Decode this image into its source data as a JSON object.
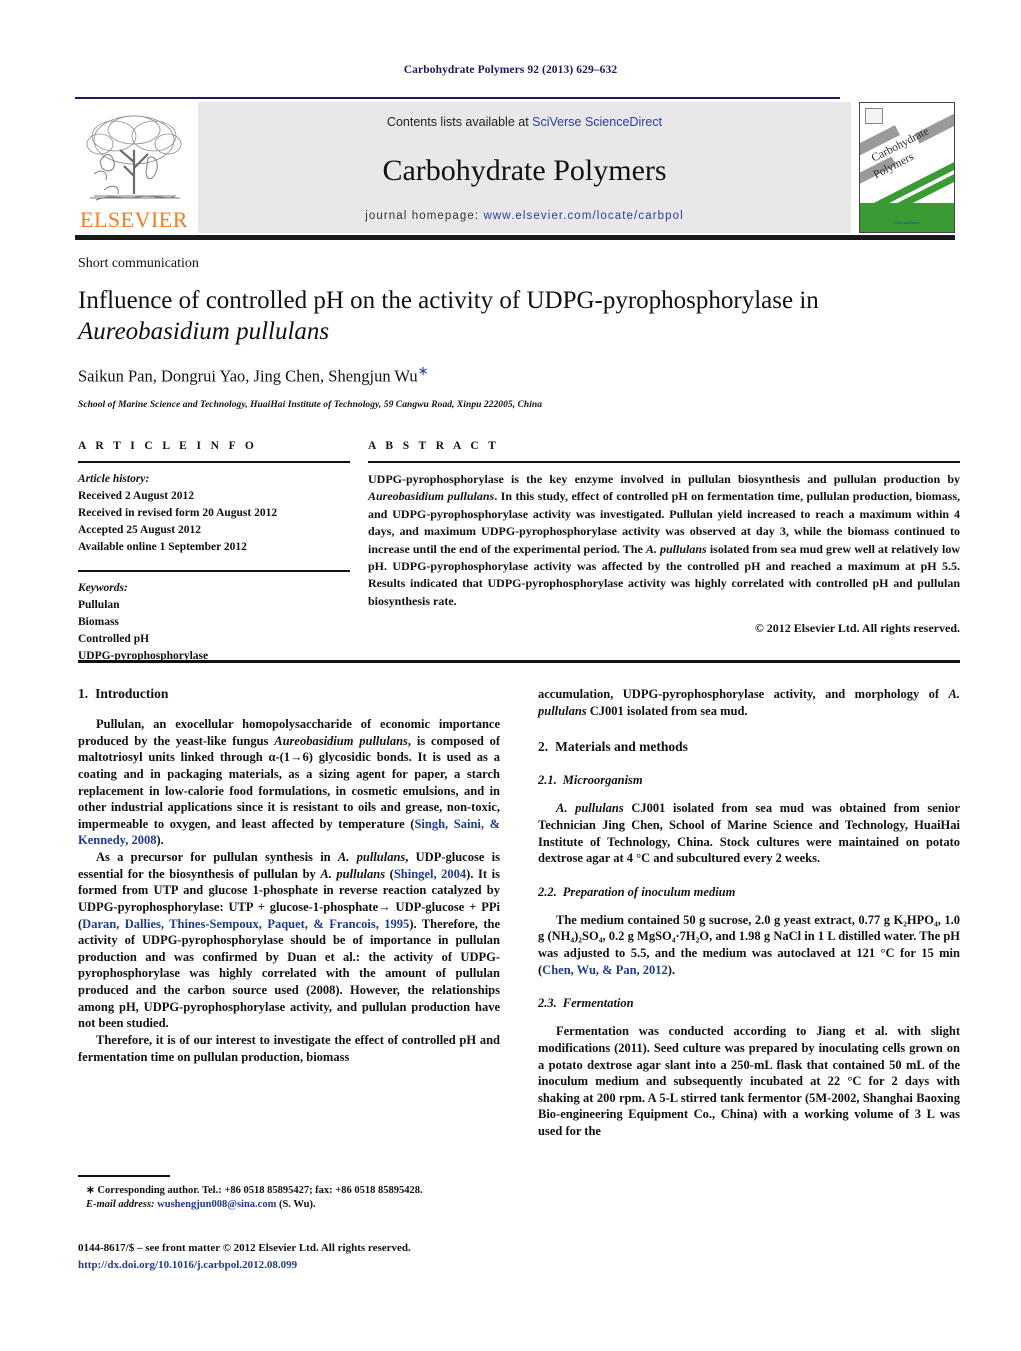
{
  "header": {
    "citation": "Carbohydrate Polymers 92 (2013) 629–632",
    "contents_prefix": "Contents lists available at ",
    "contents_link": "SciVerse ScienceDirect",
    "journal_title": "Carbohydrate Polymers",
    "homepage_prefix": "journal homepage: ",
    "homepage_url": "www.elsevier.com/locate/carbpol",
    "publisher_logo_text": "ELSEVIER",
    "cover": {
      "line1": "Carbohydrate",
      "line2": "Polymers",
      "sciencedirect": "ScienceDirect"
    },
    "colors": {
      "link_blue": "#2b3fa0",
      "elsevier_orange": "#F47B20",
      "band_gray": "#e8e8ea",
      "navy": "#1a1a5e",
      "cover_green": "#3a9b35"
    }
  },
  "title_block": {
    "doctype": "Short communication",
    "title_part1": "Influence of controlled pH on the activity of UDPG-pyrophosphorylase in ",
    "title_italic": "Aureobasidium pullulans",
    "authors": "Saikun Pan, Dongrui Yao, Jing Chen, Shengjun Wu",
    "corresponding_marker": "∗",
    "affiliation": "School of Marine Science and Technology, HuaiHai Institute of Technology, 59 Cangwu Road, Xinpu 222005, China"
  },
  "article_info": {
    "heading": "A R T I C L E    I N F O",
    "history_label": "Article history:",
    "history": [
      "Received 2 August 2012",
      "Received in revised form 20 August 2012",
      "Accepted 25 August 2012",
      "Available online 1 September 2012"
    ],
    "keywords_label": "Keywords:",
    "keywords": [
      "Pullulan",
      "Biomass",
      "Controlled pH",
      "UDPG-pyrophosphorylase"
    ]
  },
  "abstract": {
    "heading": "A B S T R A C T",
    "s1": "UDPG-pyrophosphorylase is the key enzyme involved in pullulan biosynthesis and pullulan production by ",
    "s2_italic": "Aureobasidium pullulans",
    "s3": ". In this study, effect of controlled pH on fermentation time, pullulan production, biomass, and UDPG-pyrophosphorylase activity was investigated. Pullulan yield increased to reach a maximum within 4 days, and maximum UDPG-pyrophosphorylase activity was observed at day 3, while the biomass continued to increase until the end of the experimental period. The ",
    "s4_italic": "A. pullulans",
    "s5": " isolated from sea mud grew well at relatively low pH. UDPG-pyrophosphorylase activity was affected by the controlled pH and reached a maximum at pH 5.5. Results indicated that UDPG-pyrophosphorylase activity was highly correlated with controlled pH and pullulan biosynthesis rate.",
    "copyright": "© 2012 Elsevier Ltd. All rights reserved."
  },
  "body": {
    "left": {
      "intro_num": "1.",
      "intro_title": "Introduction",
      "p1_a": "Pullulan, an exocellular homopolysaccharide of economic importance produced by the yeast-like fungus ",
      "p1_ital": "Aureobasidium pullulans",
      "p1_b": ", is composed of maltotriosyl units linked through α-(1→6) glycosidic bonds. It is used as a coating and in packaging materials, as a sizing agent for paper, a starch replacement in low-calorie food formulations, in cosmetic emulsions, and in other industrial applications since it is resistant to oils and grease, non-toxic, impermeable to oxygen, and least affected by temperature (",
      "p1_ref": "Singh, Saini, & Kennedy, 2008",
      "p1_c": ").",
      "p2_a": "As a precursor for pullulan synthesis in ",
      "p2_ital1": "A. pullulans",
      "p2_b": ", UDP-glucose is essential for the biosynthesis of pullulan by ",
      "p2_ital2": "A. pullulans",
      "p2_c": " (",
      "p2_ref1": "Shingel, 2004",
      "p2_d": "). It is formed from UTP and glucose 1-phosphate in reverse reaction catalyzed by UDPG-pyrophosphorylase: UTP + glucose-1-phosphate→ UDP-glucose + PPi (",
      "p2_ref2": "Daran, Dallies, Thines-Sempoux, Paquet, & Francois, 1995",
      "p2_e": "). Therefore, the activity of UDPG-pyrophosphorylase should be of importance in pullulan production and was confirmed by Duan et al.: the activity of UDPG-pyrophosphorylase was highly correlated with the amount of pullulan produced and the carbon source used (2008). However, the relationships among pH, UDPG-pyrophosphorylase activity, and pullulan production have not been studied.",
      "p3": "Therefore, it is of our interest to investigate the effect of controlled pH and fermentation time on pullulan production, biomass"
    },
    "right": {
      "p_cont_a": "accumulation, UDPG-pyrophosphorylase activity, and morphology of ",
      "p_cont_ital": "A. pullulans",
      "p_cont_b": " CJ001 isolated from sea mud.",
      "mm_num": "2.",
      "mm_title": "Materials and methods",
      "s21_num": "2.1.",
      "s21_title": "Microorganism",
      "s21_a_ital": "A. pullulans",
      "s21_a": " CJ001 isolated from sea mud was obtained from senior Technician Jing Chen, School of Marine Science and Technology, HuaiHai Institute of Technology, China. Stock cultures were maintained on potato dextrose agar at 4 °C and subcultured every 2 weeks.",
      "s22_num": "2.2.",
      "s22_title": "Preparation of inoculum medium",
      "s22_a": "The medium contained 50 g sucrose, 2.0 g yeast extract, 0.77 g K₂HPO₄, 1.0 g (NH₄)₂SO₄, 0.2 g MgSO₄·7H₂O, and 1.98 g NaCl in 1 L distilled water. The pH was adjusted to 5.5, and the medium was autoclaved at 121 °C for 15 min (",
      "s22_ref": "Chen, Wu, & Pan, 2012",
      "s22_b": ").",
      "s23_num": "2.3.",
      "s23_title": "Fermentation",
      "s23_a": "Fermentation was conducted according to Jiang et al. with slight modifications (2011). Seed culture was prepared by inoculating cells grown on a potato dextrose agar slant into a 250-mL flask that contained 50 mL of the inoculum medium and subsequently incubated at 22 °C for 2 days with shaking at 200 rpm. A 5-L stirred tank fermentor (5M-2002, Shanghai Baoxing Bio-engineering Equipment Co., China) with a working volume of 3 L was used for the"
    }
  },
  "footnote": {
    "line1": "∗ Corresponding author. Tel.: +86 0518 85895427; fax: +86 0518 85895428.",
    "email_label": "E-mail address:",
    "email": "wushengjun008@sina.com",
    "email_suffix": " (S. Wu)."
  },
  "footer": {
    "issn": "0144-8617/$ – see front matter © 2012 Elsevier Ltd. All rights reserved.",
    "doi": "http://dx.doi.org/10.1016/j.carbpol.2012.08.099"
  }
}
